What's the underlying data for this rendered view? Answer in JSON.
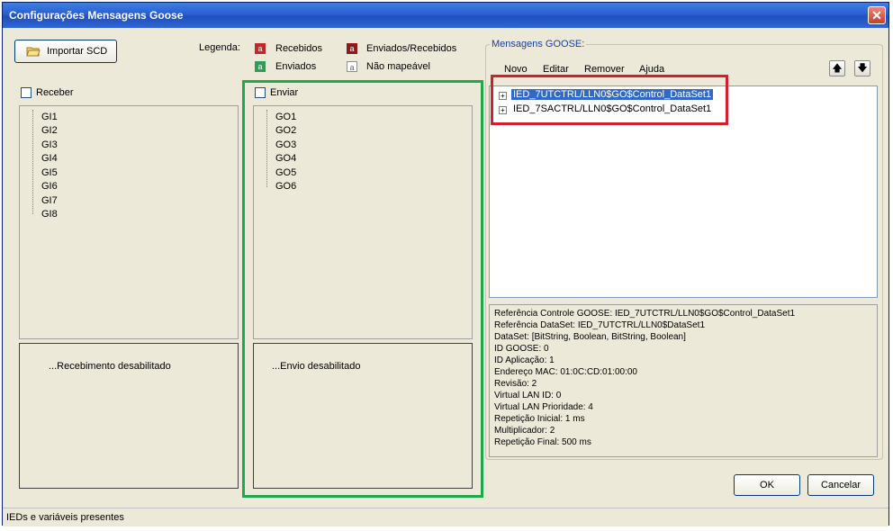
{
  "window": {
    "title": "Configurações Mensagens Goose",
    "close": "✕"
  },
  "toolbar": {
    "import_label": "Importar SCD"
  },
  "legend": {
    "label": "Legenda:",
    "items": [
      {
        "glyph": "a",
        "text": "Recebidos",
        "color": "#c0282d"
      },
      {
        "glyph": "a",
        "text": "Enviados/Recebidos",
        "color": "#8b1a1a"
      },
      {
        "glyph": "a",
        "text": "Enviados",
        "color": "#2e9e57"
      },
      {
        "glyph": "a",
        "text": "Não mapeável",
        "color": "#ffffff"
      }
    ]
  },
  "receive": {
    "checkbox_label": "Receber",
    "items": [
      "GI1",
      "GI2",
      "GI3",
      "GI4",
      "GI5",
      "GI6",
      "GI7",
      "GI8"
    ],
    "status": "...Recebimento desabilitado"
  },
  "send": {
    "checkbox_label": "Enviar",
    "items": [
      "GO1",
      "GO2",
      "GO3",
      "GO4",
      "GO5",
      "GO6"
    ],
    "status": "...Envio desabilitado"
  },
  "goose": {
    "group_label": "Mensagens GOOSE:",
    "menu": [
      "Novo",
      "Editar",
      "Remover",
      "Ajuda"
    ],
    "up_arrow": "🡅",
    "down_arrow": "🡇",
    "messages": [
      "IED_7UTCTRL/LLN0$GO$Control_DataSet1",
      "IED_7SACTRL/LLN0$GO$Control_DataSet1"
    ],
    "details": [
      "Referência Controle GOOSE: IED_7UTCTRL/LLN0$GO$Control_DataSet1",
      "Referência DataSet: IED_7UTCTRL/LLN0$DataSet1",
      "DataSet: [BitString, Boolean, BitString, Boolean]",
      "ID GOOSE: 0",
      "ID Aplicação: 1",
      "Endereço MAC: 01:0C:CD:01:00:00",
      "Revisão: 2",
      "Virtual LAN ID: 0",
      "Virtual LAN Prioridade: 4",
      "Repetição Inicial: 1 ms",
      "Multiplicador: 2",
      "Repetição Final: 500 ms"
    ]
  },
  "buttons": {
    "ok": "OK",
    "cancel": "Cancelar"
  },
  "status_bar": {
    "text": "IEDs e variáveis presentes"
  },
  "colors": {
    "highlight_red": "#d0202a",
    "highlight_green": "#1eaa4a",
    "selection": "#316ac5"
  }
}
